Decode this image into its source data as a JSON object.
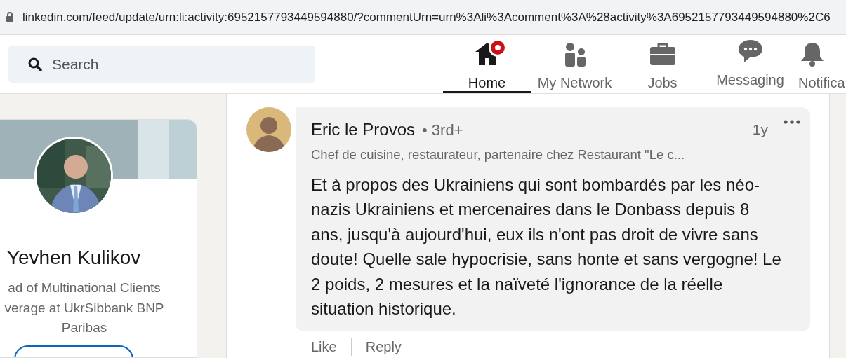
{
  "address_bar": {
    "url": "linkedin.com/feed/update/urn:li:activity:6952157793449594880/?commentUrn=urn%3Ali%3Acomment%3A%28activity%3A6952157793449594880%2C6"
  },
  "search": {
    "placeholder": "Search"
  },
  "nav": [
    {
      "label": "Home",
      "kind": "home",
      "selected": true,
      "notification": true
    },
    {
      "label": "My Network",
      "kind": "network",
      "selected": false,
      "notification": false
    },
    {
      "label": "Jobs",
      "kind": "jobs",
      "selected": false,
      "notification": false
    },
    {
      "label": "Messaging",
      "kind": "messaging",
      "selected": false,
      "notification": false
    },
    {
      "label": "Notifica",
      "kind": "bell",
      "selected": false,
      "notification": false
    }
  ],
  "profile": {
    "name": "Yevhen Kulikov",
    "headline_lines": [
      "ad of Multinational Clients",
      "verage at UkrSibbank BNP",
      "Paribas"
    ]
  },
  "comment": {
    "author": "Eric le Provos",
    "degree": "• 3rd+",
    "subtitle": "Chef de cuisine, restaurateur, partenaire chez Restaurant \"Le c...",
    "time": "1y",
    "text": "Et à propos des Ukrainiens qui sont bombardés par les néo-nazis Ukrainiens et mercenaires dans le Donbass depuis 8 ans, jusqu'à aujourd'hui, eux ils n'ont pas droit de vivre sans doute! Quelle sale hypocrisie, sans honte et sans vergogne! Le 2 poids, 2 mesures et la naïveté l'ignorance de la réelle situation historique.",
    "actions": [
      "Like",
      "Reply"
    ]
  }
}
